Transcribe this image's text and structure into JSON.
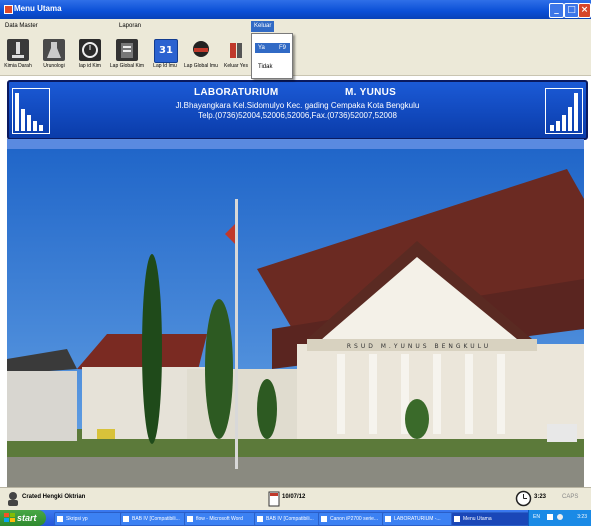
{
  "window": {
    "title": "Menu Utama"
  },
  "menubar": {
    "items": [
      "Data Master",
      "Laporan",
      "Keluar"
    ]
  },
  "toolbar": {
    "buttons": [
      "Kimia Darah",
      "Urunologi",
      "lap id Kim",
      "Lap Global Kim",
      "Lap Id Imu",
      "Lap Global Imu",
      "Keluar Yes"
    ]
  },
  "calendar_badge": "31",
  "dropdown": {
    "items": [
      "Ya",
      "F9",
      "Tidak"
    ]
  },
  "banner": {
    "title_left": "LABORATURIUM",
    "title_right": "M. YUNUS",
    "line2": "Jl.Bhayangkara Kel.Sidomulyo Kec. gading Cempaka Kota Bengkulu",
    "line3": "Telp.(0736)52004,52006,52006,Fax.(0736)52007,52008"
  },
  "building_sign": "RSUD M.YUNUS BENGKULU",
  "statusbar": {
    "credit": "Crated Hengki Oktrian",
    "date": "10/07/12",
    "time": "3:23",
    "caps": "CAPS"
  },
  "taskbar": {
    "start_label": "start",
    "tasks": [
      "Skripsi yp",
      "BAB IV [Compatibili...",
      "flow - Microsoft Word",
      "BAB IV [Compatibili...",
      "Canon iP2700 serie...",
      "LABORATURIUM -...",
      "Menu Utama"
    ],
    "tray_lang": "EN",
    "tray_time": "3:23"
  },
  "colors": {
    "title_blue": "#0a4fd6",
    "banner_blue": "#1b5ad6",
    "menu_highlight": "#316ac5",
    "start_green": "#3e9c3e"
  }
}
